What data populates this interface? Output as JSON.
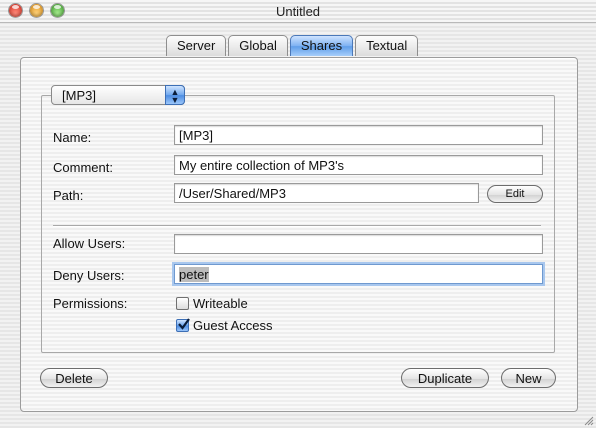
{
  "window": {
    "title": "Untitled",
    "traffic_lights": {
      "close": "#e0443e",
      "minimize": "#e8a23a",
      "zoom": "#4bb04a"
    }
  },
  "tabs": [
    {
      "label": "Server",
      "active": false
    },
    {
      "label": "Global",
      "active": false
    },
    {
      "label": "Shares",
      "active": true
    },
    {
      "label": "Textual",
      "active": false
    }
  ],
  "share_popup": {
    "selected": "[MP3]"
  },
  "form": {
    "name_label": "Name:",
    "name_value": "[MP3]",
    "comment_label": "Comment:",
    "comment_value": "My entire collection of MP3's",
    "path_label": "Path:",
    "path_value": "/User/Shared/MP3",
    "edit_label": "Edit",
    "allow_label": "Allow Users:",
    "allow_value": "",
    "deny_label": "Deny Users:",
    "deny_value": "peter",
    "permissions_label": "Permissions:",
    "writeable_label": "Writeable",
    "writeable_checked": false,
    "guest_label": "Guest Access",
    "guest_checked": true
  },
  "buttons": {
    "delete": "Delete",
    "duplicate": "Duplicate",
    "new": "New"
  },
  "accent": "#5f9de9"
}
